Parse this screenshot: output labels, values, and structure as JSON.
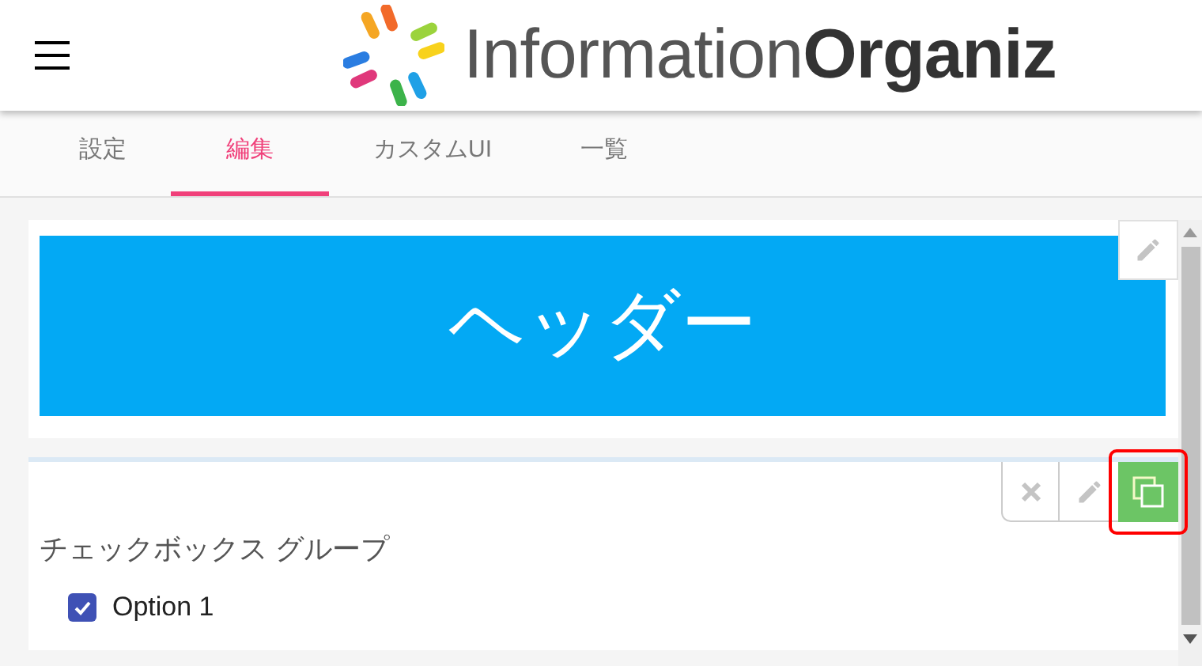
{
  "app_bar": {
    "logo_text": "Information**Organiz**"
  },
  "tabs": [
    {
      "label": "設定",
      "selected": false
    },
    {
      "label": "編集",
      "selected": true
    },
    {
      "label": "カスタムUI",
      "selected": false
    },
    {
      "label": "一覧",
      "selected": false
    }
  ],
  "header_block": {
    "text": "ヘッダー"
  },
  "checkbox_group": {
    "label": "チェックボックス グループ",
    "options": [
      {
        "label": "Option 1",
        "checked": true
      }
    ],
    "copy_highlighted": true
  }
}
